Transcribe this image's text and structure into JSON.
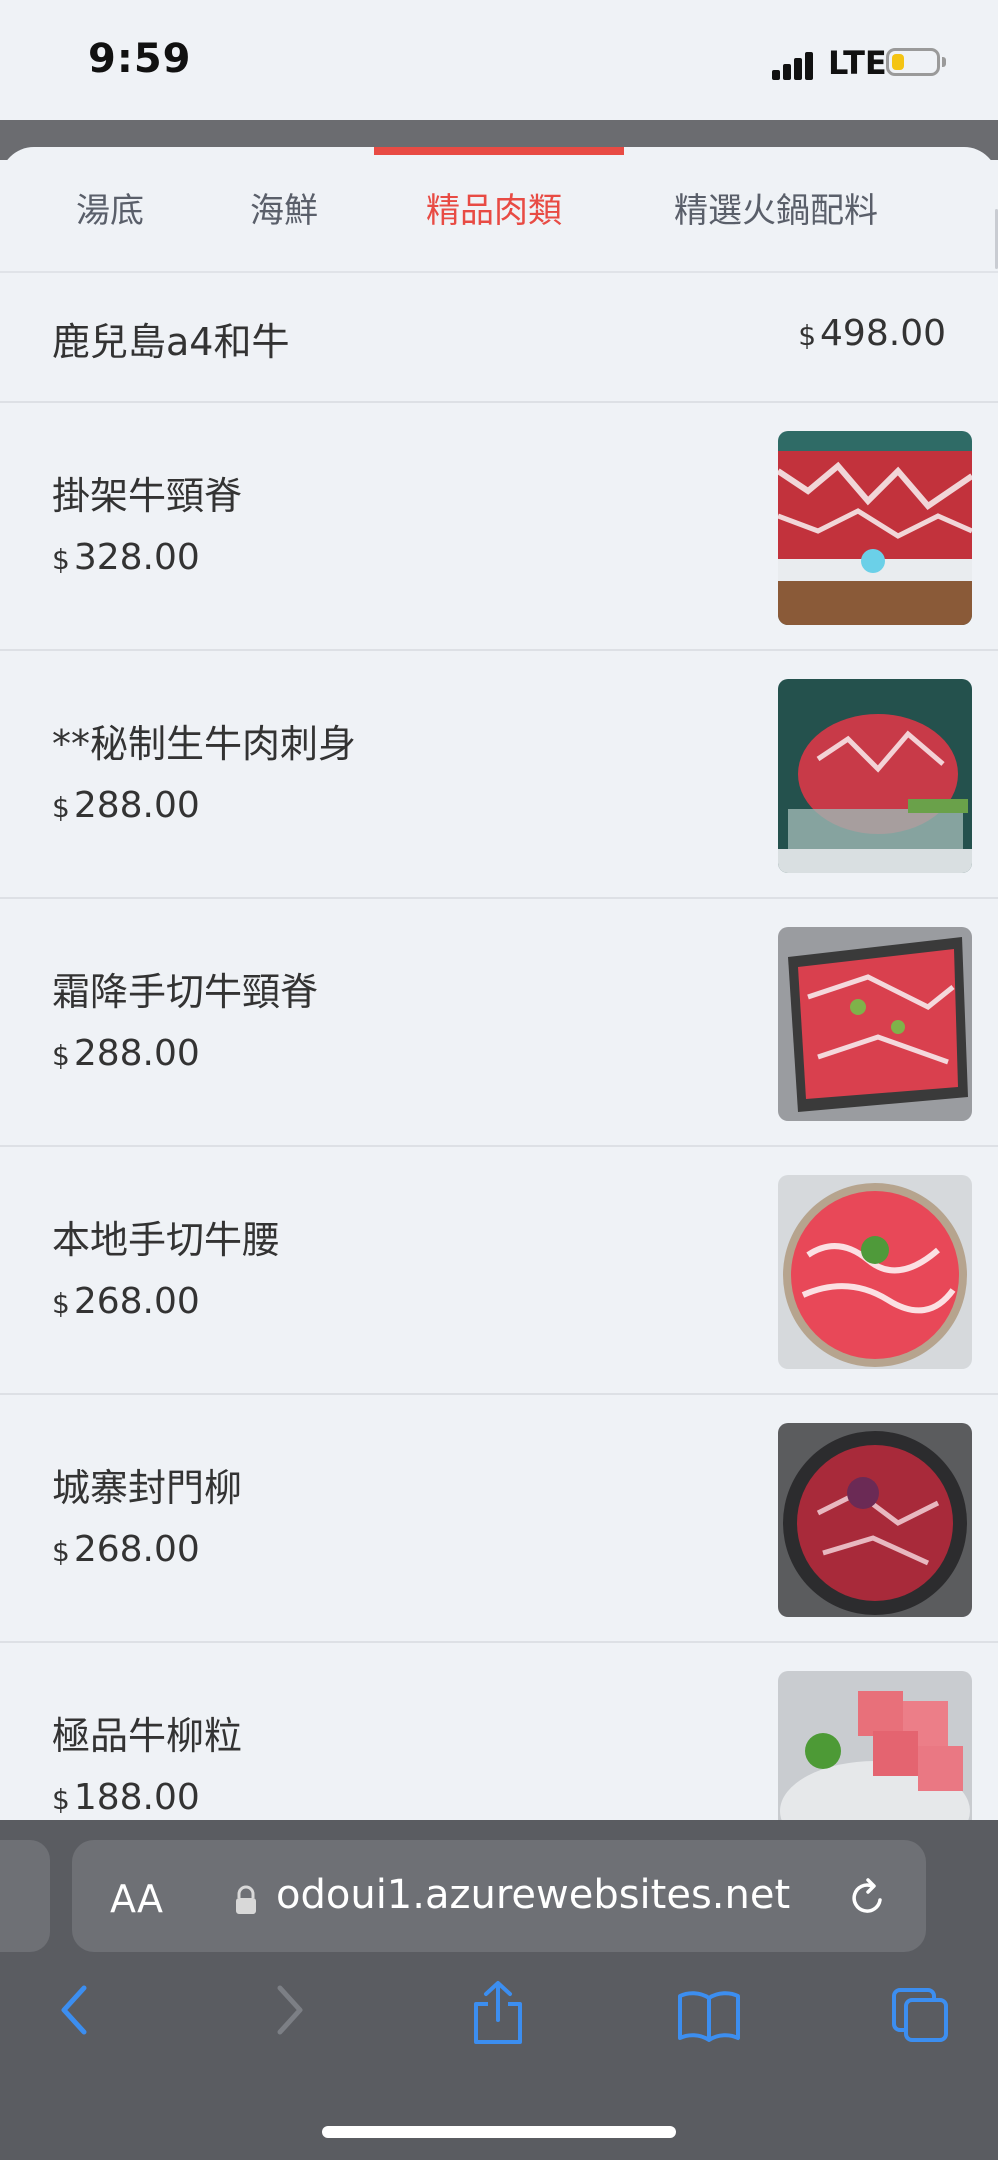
{
  "status": {
    "time": "9:59",
    "network": "LTE"
  },
  "tabs": [
    {
      "label": "湯底",
      "active": false
    },
    {
      "label": "海鮮",
      "active": false
    },
    {
      "label": "精品肉類",
      "active": true
    },
    {
      "label": "精選火鍋配料",
      "active": false
    }
  ],
  "accent_color": "#e84b44",
  "menu": {
    "currency": "$",
    "items": [
      {
        "name": "鹿兒島a4和牛",
        "price": "498.00",
        "image": false
      },
      {
        "name": "掛架牛頸脊",
        "price": "328.00",
        "image": true
      },
      {
        "name": "**秘制生牛肉刺身",
        "price": "288.00",
        "image": true
      },
      {
        "name": "霜降手切牛頸脊",
        "price": "288.00",
        "image": true
      },
      {
        "name": "本地手切牛腰",
        "price": "268.00",
        "image": true
      },
      {
        "name": "城寨封門柳",
        "price": "268.00",
        "image": true
      },
      {
        "name": "極品牛柳粒",
        "price": "188.00",
        "image": true
      }
    ]
  },
  "browser": {
    "text_size_label": "AA",
    "url": "odoui1.azurewebsites.net"
  },
  "icons": {
    "back": "chevron-left-icon",
    "forward": "chevron-right-icon",
    "share": "share-icon",
    "bookmarks": "book-icon",
    "tabs": "tabs-icon",
    "reload": "reload-icon",
    "lock": "lock-icon"
  }
}
